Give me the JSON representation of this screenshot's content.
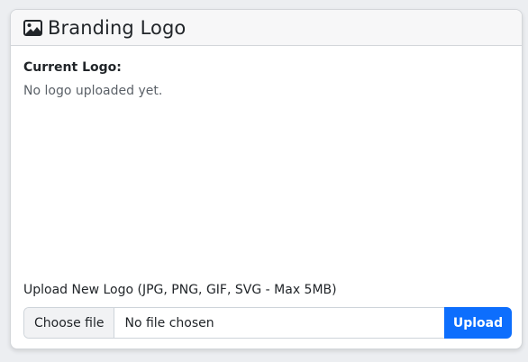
{
  "card": {
    "title": "Branding Logo",
    "icon": "image-icon"
  },
  "current_logo": {
    "label": "Current Logo:",
    "status": "No logo uploaded yet."
  },
  "upload": {
    "label": "Upload New Logo (JPG, PNG, GIF, SVG - Max 5MB)",
    "choose_label": "Choose file",
    "file_status": "No file chosen",
    "button_label": "Upload"
  },
  "colors": {
    "accent": "#0d6efd",
    "background": "#eceef1",
    "card": "#ffffff",
    "header": "#f7f7f8"
  }
}
